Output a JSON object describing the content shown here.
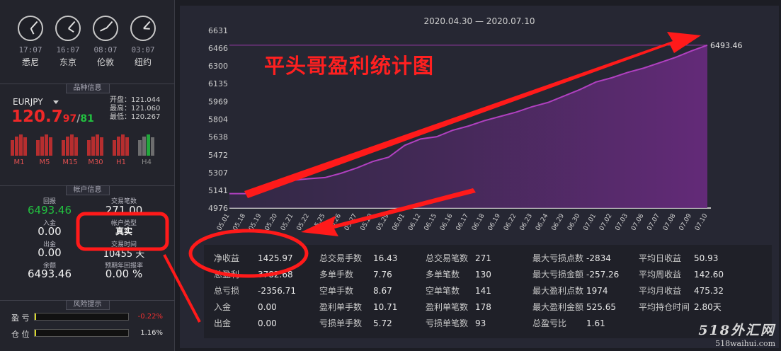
{
  "clocks": [
    {
      "time": "17:07",
      "city": "悉尼",
      "h": 17,
      "m": 7
    },
    {
      "time": "16:07",
      "city": "东京",
      "h": 16,
      "m": 7
    },
    {
      "time": "08:07",
      "city": "伦敦",
      "h": 8,
      "m": 7
    },
    {
      "time": "03:07",
      "city": "纽约",
      "h": 3,
      "m": 7
    }
  ],
  "product": {
    "header": "品种信息",
    "symbol": "EURJPY",
    "price_big": "120.7",
    "price_bid": "97",
    "price_sep": "/",
    "price_ask": "81",
    "open": "开盘：121.044",
    "high": "最高：121.060",
    "low": "最低：120.267",
    "timeframes": [
      {
        "label": "M1",
        "color": "#d03030"
      },
      {
        "label": "M5",
        "color": "#d03030"
      },
      {
        "label": "M15",
        "color": "#d03030"
      },
      {
        "label": "M30",
        "color": "#d03030"
      },
      {
        "label": "H1",
        "color": "#d03030"
      },
      {
        "label": "H4",
        "color": "#7a7a7a"
      }
    ]
  },
  "account": {
    "header": "帐户信息",
    "equity_label": "回报",
    "equity": "6493.46",
    "trades_label": "交易笔数",
    "trades": "271.00",
    "deposit_label": "入金",
    "deposit": "0.00",
    "type_label": "帐户类型",
    "type": "真实",
    "withdraw_label": "出金",
    "withdraw": "0.00",
    "time_label": "交易时间",
    "time": "10455 天",
    "balance_label": "余额",
    "balance": "6493.46",
    "annual_label": "预期年回报率",
    "annual": "0.00 %"
  },
  "risk": {
    "header": "风险提示",
    "profit_label": "盈  亏",
    "profit_val": "-0.22%",
    "position_label": "仓  位",
    "position_val": "1.16%"
  },
  "chart": {
    "subtitle": "2020.04.30 — 2020.07.10",
    "overlay_text": "平头哥盈利统计图",
    "max_label": "6493.46"
  },
  "chart_data": {
    "type": "area",
    "title": "2020.04.30 — 2020.07.10",
    "yticks": [
      "6631",
      "6466",
      "6300",
      "6135",
      "5969",
      "5804",
      "5638",
      "5472",
      "5307",
      "5141",
      "4976"
    ],
    "ylim": [
      4976,
      6631
    ],
    "categories": [
      "05.01",
      "05.18",
      "05.19",
      "05.20",
      "05.21",
      "05.22",
      "05.25",
      "05.26",
      "05.27",
      "05.28",
      "05.29",
      "06.01",
      "06.12",
      "06.15",
      "06.16",
      "06.17",
      "06.18",
      "06.19",
      "06.22",
      "06.23",
      "06.24",
      "06.29",
      "06.30",
      "07.01",
      "07.02",
      "07.03",
      "07.06",
      "07.07",
      "07.08",
      "07.09",
      "07.10"
    ],
    "values": [
      5110,
      5110,
      5170,
      5215,
      5235,
      5250,
      5260,
      5300,
      5350,
      5410,
      5450,
      5560,
      5620,
      5640,
      5700,
      5740,
      5790,
      5830,
      5870,
      5920,
      5960,
      6020,
      6080,
      6150,
      6190,
      6240,
      6280,
      6330,
      6380,
      6440,
      6493.46
    ],
    "reference_line": 6493.46
  },
  "stats": [
    [
      {
        "k": "净收益",
        "v": "1425.97"
      },
      {
        "k": "总盈利",
        "v": "3782.68"
      },
      {
        "k": "总亏损",
        "v": "-2356.71"
      },
      {
        "k": "入金",
        "v": "0.00"
      },
      {
        "k": "出金",
        "v": "0.00"
      }
    ],
    [
      {
        "k": "总交易手数",
        "v": "16.43"
      },
      {
        "k": "多单手数",
        "v": "7.76"
      },
      {
        "k": "空单手数",
        "v": "8.67"
      },
      {
        "k": "盈利单手数",
        "v": "10.71"
      },
      {
        "k": "亏损单手数",
        "v": "5.72"
      }
    ],
    [
      {
        "k": "总交易笔数",
        "v": "271"
      },
      {
        "k": "多单笔数",
        "v": "130"
      },
      {
        "k": "空单笔数",
        "v": "141"
      },
      {
        "k": "盈利单笔数",
        "v": "178"
      },
      {
        "k": "亏损单笔数",
        "v": "93"
      }
    ],
    [
      {
        "k": "最大亏损点数",
        "v": "-2834"
      },
      {
        "k": "最大亏损金额",
        "v": "-257.26"
      },
      {
        "k": "最大盈利点数",
        "v": "1974"
      },
      {
        "k": "最大盈利金额",
        "v": "525.65"
      },
      {
        "k": "总盈亏比",
        "v": "1.61"
      }
    ],
    [
      {
        "k": "平均日收益",
        "v": "50.93"
      },
      {
        "k": "平均周收益",
        "v": "142.60"
      },
      {
        "k": "平均月收益",
        "v": "475.32"
      },
      {
        "k": "平均持仓时间",
        "v": "2.80天"
      }
    ]
  ],
  "watermark": {
    "line1": "518外汇网",
    "line2": "518waihui.com"
  },
  "colors": {
    "up": "#22c040",
    "down": "#ee2828",
    "line": "#b040c0",
    "annotation": "#ff1a1a"
  }
}
